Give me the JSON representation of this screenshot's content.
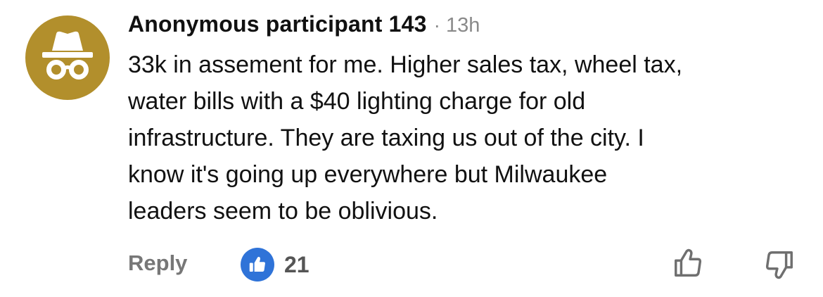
{
  "comment": {
    "author": "Anonymous participant 143",
    "separator": "·",
    "timestamp": "13h",
    "avatar_icon": "incognito-hat-glasses-icon",
    "avatar_color": "#b28f2c",
    "text": "33k in assement for me. Higher sales tax, wheel tax,\nwater bills with a $40 lighting charge for old\ninfrastructure. They are taxing us out of the city. I\nknow it's going up everywhere but Milwaukee\nleaders seem to be oblivious."
  },
  "actions": {
    "reply_label": "Reply",
    "like_count": "21",
    "like_badge_color": "#2f73d8",
    "like_badge_icon": "thumbs-up-icon",
    "upvote_icon": "thumbs-up-outline-icon",
    "downvote_icon": "thumbs-down-outline-icon"
  }
}
